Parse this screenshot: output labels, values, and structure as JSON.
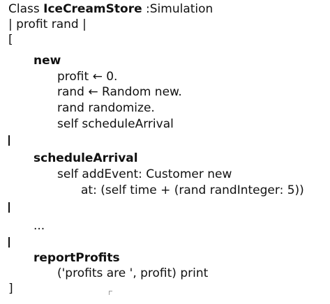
{
  "code": {
    "class_keyword": "Class ",
    "class_name": "IceCreamStore",
    "superclass_part": " :Simulation",
    "instance_vars": "| profit rand |",
    "open_bracket": "[",
    "close_bracket": "]",
    "method_new": {
      "name": "new",
      "body": [
        "profit ← 0.",
        "rand ← Random new.",
        "rand randomize.",
        "self scheduleArrival"
      ]
    },
    "method_schedule": {
      "name": "scheduleArrival",
      "body": [
        "self addEvent: Customer new",
        "at: (self time + (rand randInteger: 5))"
      ]
    },
    "ellipsis": "...",
    "method_report": {
      "name": "reportProfits",
      "body": [
        "('profits are ', profit) print"
      ]
    }
  }
}
